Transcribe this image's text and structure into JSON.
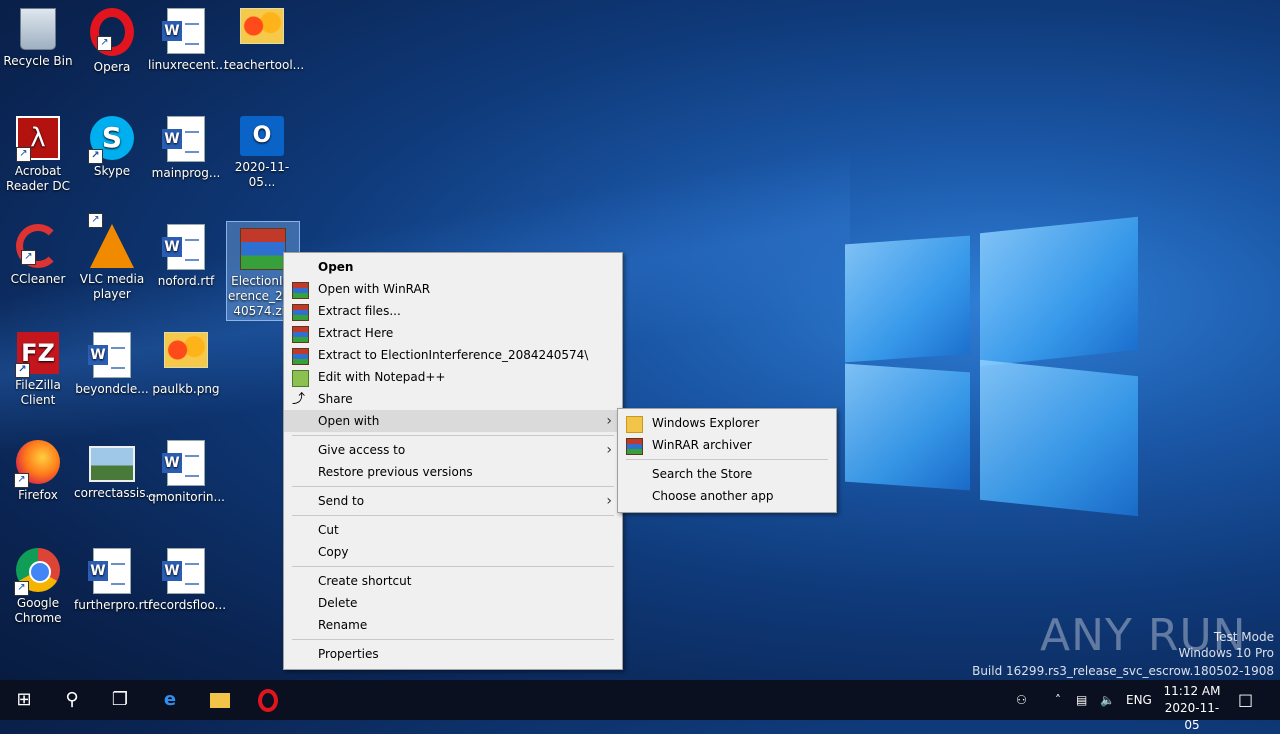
{
  "desktop": {
    "icons": [
      {
        "label": "Recycle Bin"
      },
      {
        "label": "Opera"
      },
      {
        "label": "linuxrecent..."
      },
      {
        "label": "teachertool..."
      },
      {
        "label": "Acrobat Reader DC"
      },
      {
        "label": "Skype"
      },
      {
        "label": "mainprog..."
      },
      {
        "label": "2020-11-05..."
      },
      {
        "label": "CCleaner"
      },
      {
        "label": "VLC media player"
      },
      {
        "label": "noford.rtf"
      },
      {
        "label": "ElectionInt erence_208 40574.zip"
      },
      {
        "label": "FileZilla Client"
      },
      {
        "label": "beyondcle..."
      },
      {
        "label": "paulkb.png"
      },
      {
        "label": "Firefox"
      },
      {
        "label": "correctassis..."
      },
      {
        "label": "qmonitorin..."
      },
      {
        "label": "Google Chrome"
      },
      {
        "label": "furtherpro.rtf"
      },
      {
        "label": "recordsfloo..."
      }
    ]
  },
  "context_menu": {
    "items": [
      {
        "label": "Open"
      },
      {
        "label": "Open with WinRAR"
      },
      {
        "label": "Extract files..."
      },
      {
        "label": "Extract Here"
      },
      {
        "label": "Extract to ElectionInterference_2084240574\\"
      },
      {
        "label": "Edit with Notepad++"
      },
      {
        "label": "Share"
      },
      {
        "label": "Open with"
      },
      {
        "label": "Give access to"
      },
      {
        "label": "Restore previous versions"
      },
      {
        "label": "Send to"
      },
      {
        "label": "Cut"
      },
      {
        "label": "Copy"
      },
      {
        "label": "Create shortcut"
      },
      {
        "label": "Delete"
      },
      {
        "label": "Rename"
      },
      {
        "label": "Properties"
      }
    ]
  },
  "submenu": {
    "items": [
      {
        "label": "Windows Explorer"
      },
      {
        "label": "WinRAR archiver"
      },
      {
        "label": "Search the Store"
      },
      {
        "label": "Choose another app"
      }
    ]
  },
  "watermark": {
    "brand": "ANY RUN",
    "line1": "Test Mode",
    "line2": "Windows 10 Pro",
    "line3": "Build 16299.rs3_release_svc_escrow.180502-1908"
  },
  "taskbar": {
    "lang": "ENG",
    "time": "11:12 AM",
    "date": "2020-11-05"
  },
  "colors": {
    "accent": "#1b58a8",
    "menu_bg": "#f0f0f0",
    "highlight": "#dadada"
  }
}
